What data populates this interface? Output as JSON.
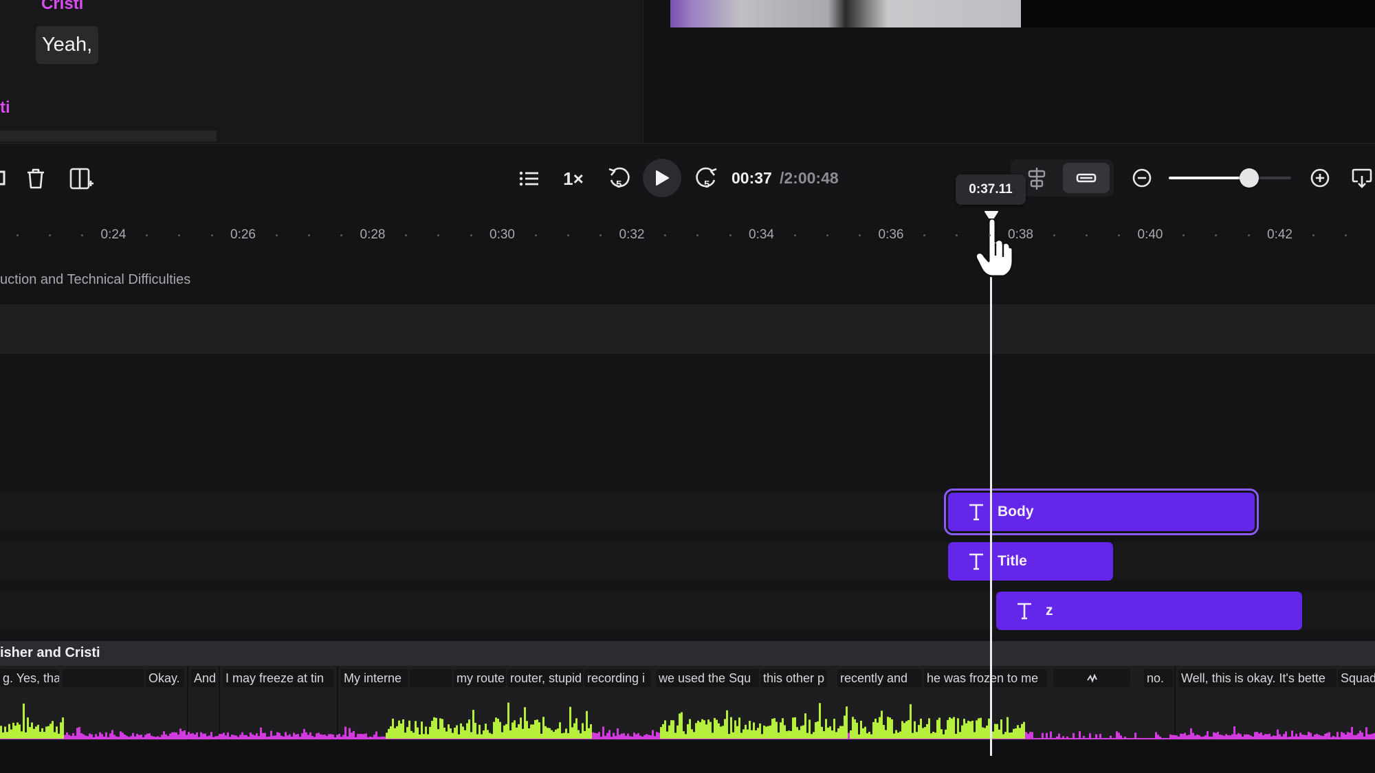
{
  "transcript": {
    "speaker_top": "Cristi",
    "caption": "Yeah,",
    "speaker_bottom": "ti"
  },
  "toolbar": {
    "speed": "1×",
    "skip_back_seconds": "5",
    "skip_forward_seconds": "5",
    "time_current": "00:37",
    "time_total": "/2:00:48",
    "zoom_level": 0.66
  },
  "ruler": {
    "labels": [
      "0:24",
      "0:26",
      "0:28",
      "0:30",
      "0:32",
      "0:34",
      "0:36",
      "0:38",
      "0:40",
      "0:42"
    ],
    "playhead_time": "0:37.11"
  },
  "tracks": {
    "chapter_title": "uction and Technical Difficulties",
    "clips": [
      {
        "label": "Body"
      },
      {
        "label": "Title"
      },
      {
        "label": "z"
      }
    ]
  },
  "audio": {
    "speakers": "isher and Cristi",
    "words": [
      "g. Yes, tha",
      "",
      "Okay.",
      "And",
      "I may freeze at tin",
      "My interne",
      "",
      "my route",
      "router, stupid",
      "recording i",
      "we used the Squ",
      "this other p",
      "recently and",
      "he was frozen to me",
      "",
      "no.",
      "Well, this is okay. It's bette",
      "Squad"
    ]
  },
  "colors": {
    "accent": "#6426e8",
    "speaker": "#d94cf0",
    "wave_active": "#b6f03c",
    "wave_inactive": "#d23ae0"
  }
}
